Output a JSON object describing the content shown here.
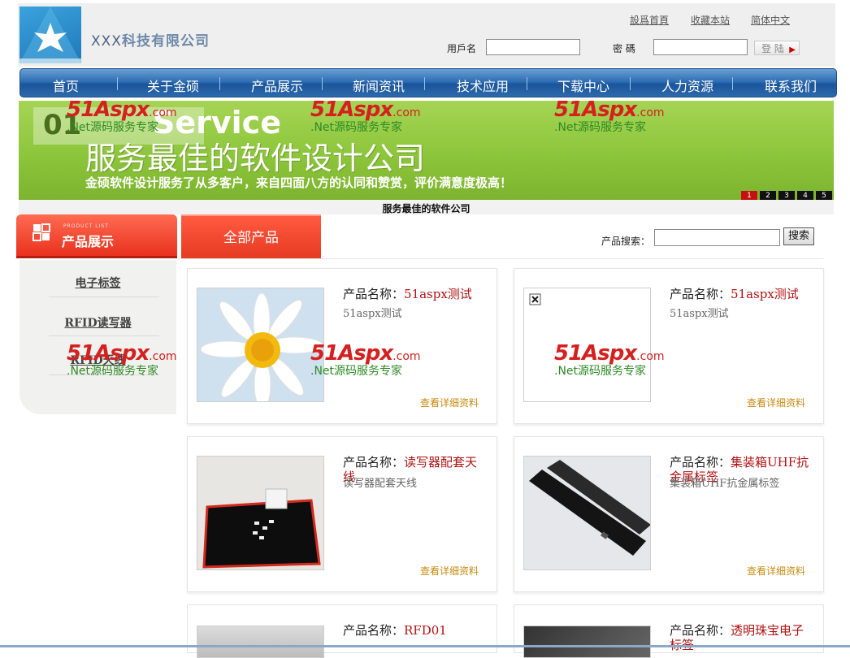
{
  "header": {
    "company_prefix": "XXX",
    "company_name": "科技有限公司",
    "links": [
      "設爲首頁",
      "收藏本站",
      "简体中文"
    ],
    "username_label": "用戶名",
    "username_value": "",
    "password_label": "密 碼",
    "password_value": "",
    "login_label": "登 陆"
  },
  "nav": {
    "items": [
      "首页",
      "关于金硕",
      "产品展示",
      "新闻资讯",
      "技术应用",
      "下载中心",
      "人力资源",
      "联系我们"
    ]
  },
  "banner": {
    "number": "01",
    "service": "Service",
    "title": "服务最佳的软件设计公司",
    "subtitle": "金硕软件设计服务了从多客户，来自四面八方的认同和赞赏，评价满意度极高！",
    "pages": [
      "1",
      "2",
      "3",
      "4",
      "5"
    ],
    "active_page": "1",
    "caption": "服务最佳的软件公司"
  },
  "watermark": {
    "brand": "51Aspx",
    "domain": ".com",
    "slogan": ".Net源码服务专家"
  },
  "sidebar": {
    "eng_label": "PRODUCT LIST",
    "title": "产品展示",
    "items": [
      "电子标签",
      "RFID读写器",
      "RFID天线"
    ]
  },
  "main": {
    "tab_label": "全部产品",
    "search_label": "产品搜索：",
    "search_value": "",
    "search_button": "搜索",
    "name_prefix": "产品名称：",
    "more_label": "查看详细资料",
    "products": [
      {
        "name": "51aspx测试",
        "desc": "51aspx测试",
        "image": "daisy"
      },
      {
        "name": "51aspx测试",
        "desc": "51aspx测试",
        "image": "broken"
      },
      {
        "name": "读写器配套天线",
        "desc": "读写器配套天线",
        "image": "antenna"
      },
      {
        "name": "集装箱UHF抗金属标签",
        "desc": "集装箱UHF抗金属标签",
        "image": "case"
      },
      {
        "name": "RFD01",
        "desc": "",
        "image": "device"
      },
      {
        "name": "透明珠宝电子标签",
        "desc": "",
        "image": "beads"
      }
    ]
  },
  "colors": {
    "nav_blue": "#2f6eb5",
    "banner_green": "#8cc63b",
    "accent_red": "#e53a22",
    "product_name_red": "#b11212",
    "more_link": "#c98a10"
  }
}
